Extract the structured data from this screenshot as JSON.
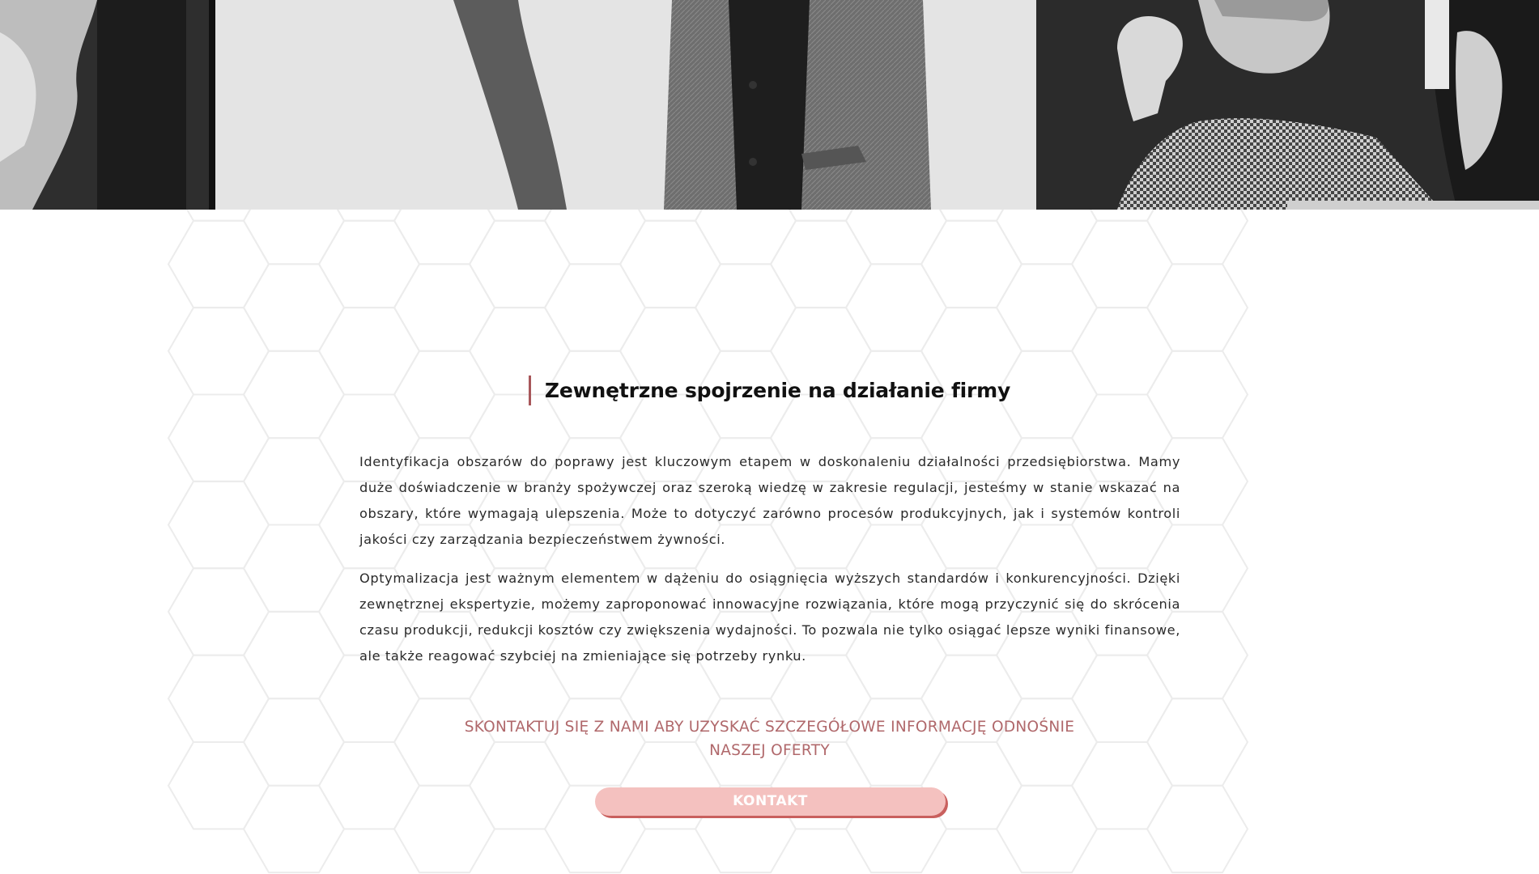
{
  "section": {
    "heading": "Zewnętrzne spojrzenie na działanie firmy",
    "paragraphs": [
      "Identyfikacja obszarów do poprawy jest kluczowym etapem w doskonaleniu działalności przedsiębiorstwa. Mamy duże doświadczenie w branży spożywczej oraz szeroką wiedzę w zakresie regulacji, jesteśmy w stanie wskazać na obszary, które wymagają ulepszenia. Może to dotyczyć zarówno procesów produkcyjnych, jak i systemów kontroli jakości czy zarządzania bezpieczeństwem żywności.",
      "Optymalizacja jest ważnym elementem w dążeniu do osiągnięcia wyższych standardów i konkurencyjności. Dzięki zewnętrznej ekspertyzie, możemy zaproponować innowacyjne rozwiązania, które mogą przyczynić się do skrócenia czasu produkcji, redukcji kosztów czy zwiększenia wydajności. To pozwala nie tylko osiągać lepsze wyniki finansowe, ale także reagować szybciej na zmieniające się potrzeby rynku."
    ],
    "cta_line1": "SKONTAKTUJ SIĘ Z NAMI ABY UZYSKAĆ SZCZEGÓŁOWE INFORMACJĘ ODNOŚNIE",
    "cta_line2": "NASZEJ OFERTY",
    "button_label": "KONTAKT"
  },
  "colors": {
    "accent": "#a8575a",
    "cta_text": "#b0686b",
    "button_bg": "#f4c1bf",
    "button_shadow": "#c9605e"
  }
}
